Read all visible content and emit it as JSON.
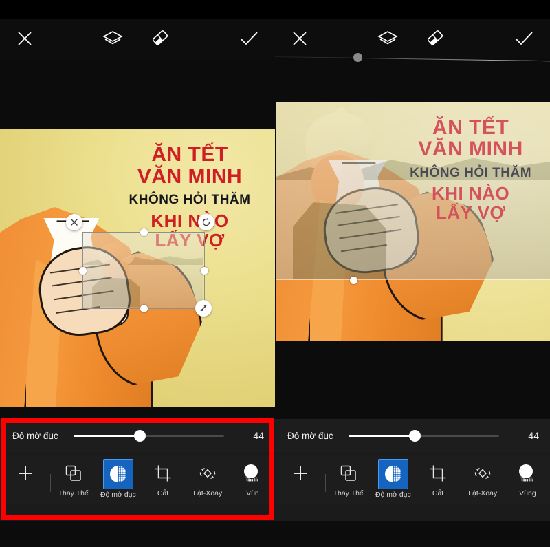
{
  "app": {
    "name": "photo-editor",
    "accent_color": "#1565c0",
    "annotation_color": "#fe0000"
  },
  "panels": [
    {
      "id": "left",
      "topbar": {
        "close_label": "close-icon",
        "layers_label": "layers-icon",
        "eraser_label": "eraser-icon",
        "done_label": "check-icon"
      },
      "has_top_slider": false,
      "artwork": {
        "headline": {
          "line1": "ĂN TẾT",
          "line2": "VĂN MINH",
          "line3": "KHÔNG HỎI THĂM",
          "line4": "KHI NÀO",
          "line5": "LẤY VỢ"
        },
        "selection": {
          "delete_icon": "close-icon",
          "rotate_icon": "rotate-icon",
          "resize_icon": "resize-diagonal-icon",
          "handles": [
            "top",
            "right",
            "bottom",
            "left"
          ]
        }
      },
      "slider": {
        "label": "Độ mờ đục",
        "value": "44",
        "percent": 44
      },
      "tools": [
        {
          "label": "",
          "icon": "plus-icon",
          "active": false
        },
        {
          "label": "Thay Thế",
          "icon": "copy-layers-icon",
          "active": false
        },
        {
          "label": "Độ mờ đục",
          "icon": "opacity-icon",
          "active": true
        },
        {
          "label": "Cắt",
          "icon": "crop-icon",
          "active": false
        },
        {
          "label": "Lật-Xoay",
          "icon": "flip-rotate-icon",
          "active": false
        },
        {
          "label": "Vùn",
          "icon": "region-icon",
          "active": false
        }
      ],
      "annotated": true
    },
    {
      "id": "right",
      "topbar": {
        "close_label": "close-icon",
        "layers_label": "layers-icon",
        "eraser_label": "eraser-icon",
        "done_label": "check-icon"
      },
      "has_top_slider": true,
      "artwork": {
        "headline": {
          "line1": "ĂN TẾT",
          "line2": "VĂN MINH",
          "line3": "KHÔNG HỎI THĂM",
          "line4": "KHI NÀO",
          "line5": "LẤY VỢ"
        },
        "selection": {
          "delete_icon": "close-icon",
          "rotate_icon": "rotate-icon",
          "resize_icon": "resize-diagonal-icon",
          "handles": [
            "bottom"
          ]
        }
      },
      "slider": {
        "label": "Độ mờ đục",
        "value": "44",
        "percent": 44
      },
      "tools": [
        {
          "label": "",
          "icon": "plus-icon",
          "active": false
        },
        {
          "label": "Thay Thế",
          "icon": "copy-layers-icon",
          "active": false
        },
        {
          "label": "Độ mờ đục",
          "icon": "opacity-icon",
          "active": true
        },
        {
          "label": "Cắt",
          "icon": "crop-icon",
          "active": false
        },
        {
          "label": "Lật-Xoay",
          "icon": "flip-rotate-icon",
          "active": false
        },
        {
          "label": "Vùng",
          "icon": "region-icon",
          "active": false
        }
      ],
      "annotated": false
    }
  ]
}
